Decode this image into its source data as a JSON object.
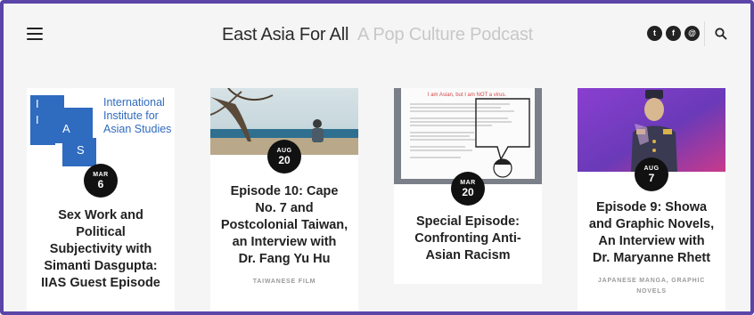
{
  "header": {
    "title": "East Asia For All",
    "tagline": "A Pop Culture Podcast",
    "menu_icon": "hamburger-menu-icon",
    "social": [
      {
        "name": "twitter-icon",
        "glyph": "t"
      },
      {
        "name": "facebook-icon",
        "glyph": "f"
      },
      {
        "name": "email-icon",
        "glyph": "@"
      }
    ],
    "search_icon": "search-icon"
  },
  "colors": {
    "frame": "#5b45a8",
    "page_bg": "#f5f5f6",
    "badge_bg": "#111111",
    "iias_blue": "#2f6bbf"
  },
  "posts": [
    {
      "date_month": "MAR",
      "date_day": "6",
      "title_lines": [
        "Sex Work and",
        "Political",
        "Subjectivity with",
        "Simanti Dasgupta:",
        "IIAS Guest Episode"
      ],
      "category": "",
      "image": {
        "letters": [
          "I",
          "I",
          "A",
          "S"
        ],
        "org_lines": [
          "International",
          "Institute for",
          "Asian Studies"
        ]
      }
    },
    {
      "date_month": "AUG",
      "date_day": "20",
      "title_lines": [
        "Episode 10: Cape",
        "No. 7 and",
        "Postcolonial Taiwan,",
        "an Interview with",
        "Dr. Fang Yu Hu"
      ],
      "category": "TAIWANESE FILM"
    },
    {
      "date_month": "MAR",
      "date_day": "20",
      "title_lines": [
        "Special Episode:",
        "Confronting Anti-",
        "Asian Racism"
      ],
      "category": "",
      "image": {
        "sign_headline": "I am Asian, but I am NOT a virus."
      }
    },
    {
      "date_month": "AUG",
      "date_day": "7",
      "title_lines": [
        "Episode 9: Showa",
        "and Graphic Novels,",
        "An Interview with",
        "Dr. Maryanne Rhett"
      ],
      "category_lines": [
        "JAPANESE MANGA, GRAPHIC",
        "NOVELS"
      ]
    }
  ]
}
